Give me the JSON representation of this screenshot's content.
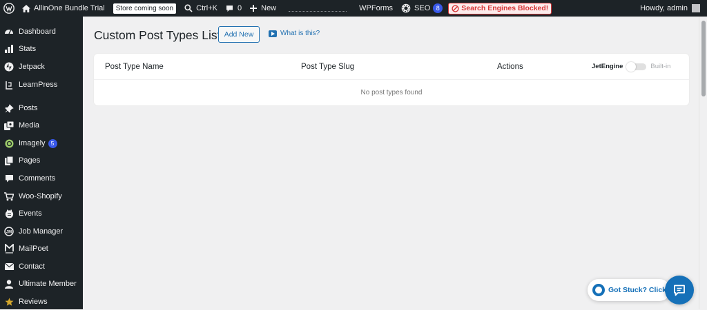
{
  "adminbar": {
    "site_name": "AllinOne Bundle Trial",
    "store_badge": "Store coming soon",
    "shortcut": "Ctrl+K",
    "comments_count": "0",
    "new_label": "New",
    "wpforms": "WPForms",
    "seo_label": "SEO",
    "seo_count": "8",
    "blocked_label": "Search Engines Blocked!",
    "howdy": "Howdy, admin"
  },
  "sidebar": {
    "items": [
      {
        "label": "Dashboard",
        "icon": "dashboard-icon"
      },
      {
        "label": "Stats",
        "icon": "stats-icon"
      },
      {
        "label": "Jetpack",
        "icon": "jetpack-icon"
      },
      {
        "label": "LearnPress",
        "icon": "learnpress-icon"
      },
      {
        "label": "Posts",
        "icon": "pin-icon"
      },
      {
        "label": "Media",
        "icon": "media-icon"
      },
      {
        "label": "Imagely",
        "icon": "imagely-icon",
        "badge": "5"
      },
      {
        "label": "Pages",
        "icon": "pages-icon"
      },
      {
        "label": "Comments",
        "icon": "comments-icon"
      },
      {
        "label": "Woo-Shopify",
        "icon": "cart-icon"
      },
      {
        "label": "Events",
        "icon": "calendar-icon"
      },
      {
        "label": "Job Manager",
        "icon": "job-manager-icon"
      },
      {
        "label": "MailPoet",
        "icon": "mailpoet-icon"
      },
      {
        "label": "Contact",
        "icon": "mail-icon"
      },
      {
        "label": "Ultimate Member",
        "icon": "user-icon"
      },
      {
        "label": "Reviews",
        "icon": "star-icon"
      }
    ]
  },
  "main": {
    "title": "Custom Post Types List",
    "add_new": "Add New",
    "whats_this": "What is this?",
    "table": {
      "col_name": "Post Type Name",
      "col_slug": "Post Type Slug",
      "col_actions": "Actions",
      "toggle_left": "JetEngine",
      "toggle_right": "Built-in",
      "toggle_on": false,
      "empty": "No post types found"
    }
  },
  "help": {
    "got_stuck": "Got Stuck? Click"
  },
  "colors": {
    "admin_bg": "#1d2327",
    "accent": "#2271b1",
    "help_blue": "#1570b8",
    "blocked_red": "#d63638"
  }
}
